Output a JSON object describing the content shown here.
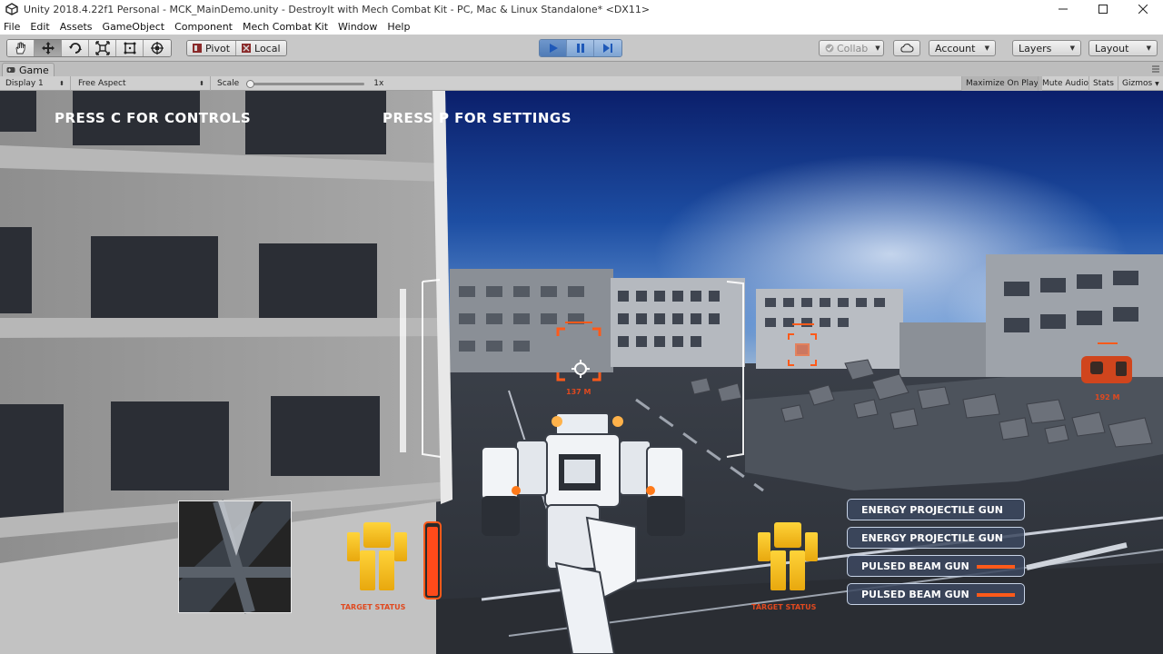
{
  "window": {
    "title": "Unity 2018.4.22f1 Personal - MCK_MainDemo.unity - DestroyIt with Mech Combat Kit - PC, Mac & Linux Standalone* <DX11>"
  },
  "menu": [
    "File",
    "Edit",
    "Assets",
    "GameObject",
    "Component",
    "Mech Combat Kit",
    "Window",
    "Help"
  ],
  "toolbar": {
    "pivot_label": "Pivot",
    "local_label": "Local",
    "collab_label": "Collab",
    "account_label": "Account",
    "layers_label": "Layers",
    "layout_label": "Layout"
  },
  "game_tab": {
    "label": "Game",
    "display": "Display 1",
    "aspect": "Free Aspect",
    "scale_label": "Scale",
    "scale_value": "1x",
    "scale_fraction": 0.0,
    "maximize_on_play": "Maximize On Play",
    "mute_audio": "Mute Audio",
    "stats": "Stats",
    "gizmos": "Gizmos"
  },
  "hud": {
    "controls_hint": "PRESS C FOR CONTROLS",
    "settings_hint": "PRESS P FOR SETTINGS",
    "target_left_distance": "137 M",
    "target_right_distance": "192 M",
    "target_status_left": "TARGET STATUS",
    "target_status_right": "TARGET STATUS",
    "weapons": [
      {
        "name": "ENERGY PROJECTILE GUN",
        "has_bar": false
      },
      {
        "name": "ENERGY PROJECTILE GUN",
        "has_bar": false
      },
      {
        "name": "PULSED BEAM GUN",
        "has_bar": true
      },
      {
        "name": "PULSED BEAM GUN",
        "has_bar": true
      }
    ]
  },
  "colors": {
    "hud_orange": "#e0491f",
    "status_yellow": "#f5c518",
    "play_blue": "#4f7bb6"
  },
  "icons": [
    "unity-icon",
    "hand-tool-icon",
    "move-tool-icon",
    "rotate-tool-icon",
    "scale-tool-icon",
    "rect-tool-icon",
    "transform-tool-icon",
    "play-icon",
    "pause-icon",
    "step-icon",
    "cloud-icon"
  ]
}
